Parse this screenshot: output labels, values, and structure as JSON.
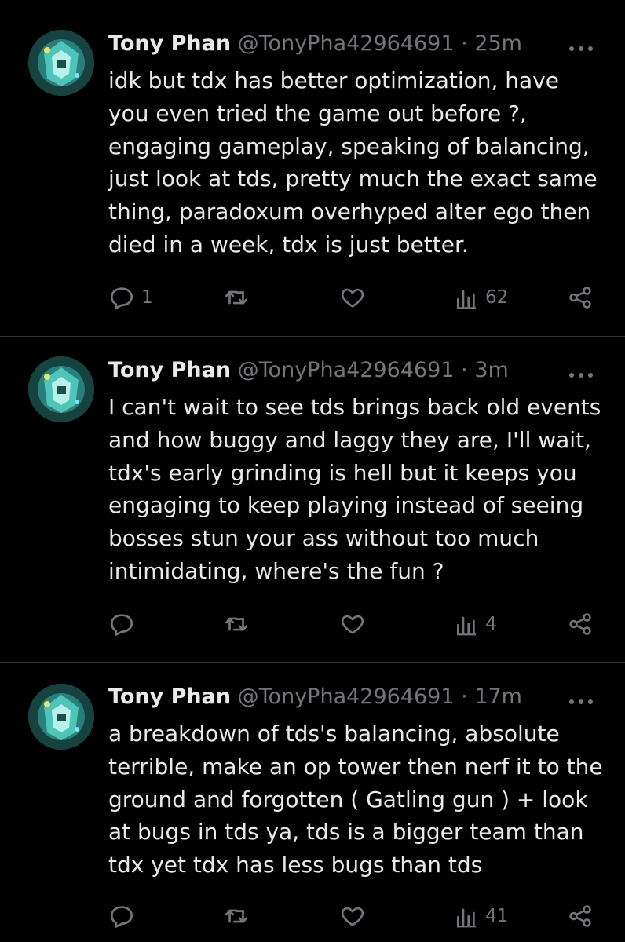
{
  "tweets": [
    {
      "name": "Tony Phan",
      "handle": "@TonyPha42964691",
      "sep": "·",
      "time": "25m",
      "lines": [
        "idk but tdx has better optimization, have",
        "you even tried the game out before ?,",
        "engaging gameplay, speaking of balancing,",
        "just look at tds, pretty much the exact same",
        "thing, paradoxum overhyped alter ego then",
        "died in a week, tdx is just better."
      ],
      "replies": "1",
      "views": "62"
    },
    {
      "name": "Tony Phan",
      "handle": "@TonyPha42964691",
      "sep": "·",
      "time": "3m",
      "lines": [
        "I can't wait to see tds brings back old events",
        "and how buggy and laggy they are, I'll wait,",
        "tdx's early grinding is hell but it keeps you",
        "engaging to keep playing instead of seeing",
        "bosses stun your ass without too much",
        "intimidating, where's the fun ?"
      ],
      "replies": "",
      "views": "4"
    },
    {
      "name": "Tony Phan",
      "handle": "@TonyPha42964691",
      "sep": "·",
      "time": "17m",
      "lines": [
        "a breakdown of tds's balancing, absolute",
        "terrible, make an op tower then nerf it to the",
        "ground and forgotten ( Gatling gun ) + look",
        "at bugs in tds ya, tds is a bigger team than",
        "tdx yet tdx has less bugs than tds"
      ],
      "replies": "",
      "views": "41"
    }
  ],
  "icons": {
    "more": "more-horizontal-icon",
    "reply": "reply-icon",
    "retweet": "retweet-icon",
    "like": "heart-icon",
    "views": "views-icon",
    "share": "share-icon"
  },
  "colors": {
    "background": "#000000",
    "text": "#e7e9ea",
    "muted": "#71767b",
    "divider": "#2f3336",
    "avatar": "#1b4f4a"
  }
}
